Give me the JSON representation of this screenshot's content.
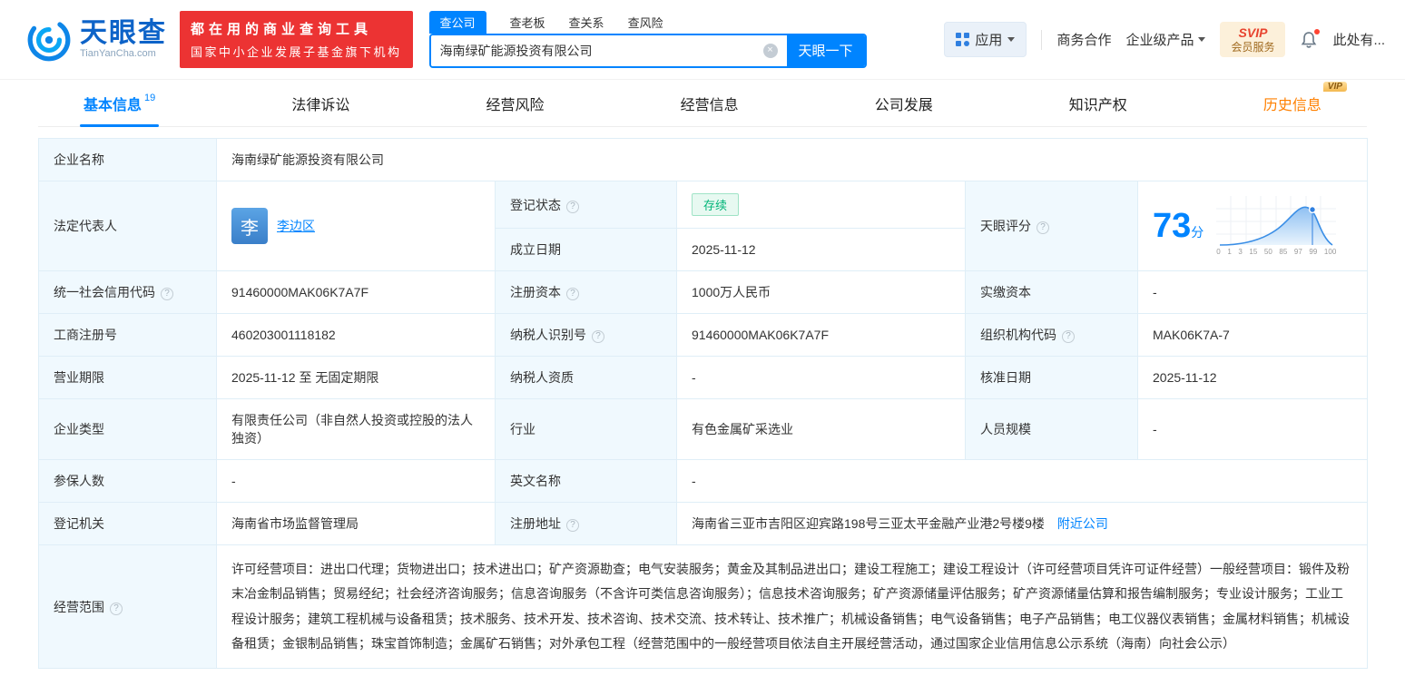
{
  "colors": {
    "primary": "#0084ff",
    "banner_red": "#ec3333",
    "status_green": "#00b578",
    "history_orange": "#ff8000"
  },
  "icons": {
    "clear": "×",
    "question": "?"
  },
  "header": {
    "logo_cn": "天眼查",
    "logo_en": "TianYanCha.com",
    "banner_line1": "都在用的商业查询工具",
    "banner_line2": "国家中小企业发展子基金旗下机构",
    "search_tabs": [
      {
        "label": "查公司"
      },
      {
        "label": "查老板"
      },
      {
        "label": "查关系"
      },
      {
        "label": "查风险"
      }
    ],
    "search_value": "海南绿矿能源投资有限公司",
    "search_button": "天眼一下",
    "apps_label": "应用",
    "biz_label": "商务合作",
    "enterprise_label": "企业级产品",
    "svip_brand": "SVIP",
    "svip_label": "会员服务",
    "notice_label": "此处有..."
  },
  "nav": {
    "tabs": [
      {
        "label": "基本信息",
        "count": "19"
      },
      {
        "label": "法律诉讼"
      },
      {
        "label": "经营风险"
      },
      {
        "label": "经营信息"
      },
      {
        "label": "公司发展"
      },
      {
        "label": "知识产权"
      },
      {
        "label": "历史信息",
        "vip": "VIP"
      }
    ]
  },
  "info": {
    "company_name_label": "企业名称",
    "company_name": "海南绿矿能源投资有限公司",
    "legal_rep_label": "法定代表人",
    "legal_rep_avatar": "李",
    "legal_rep_name": "李边区",
    "reg_status_label": "登记状态",
    "reg_status": "存续",
    "establish_label": "成立日期",
    "establish_date": "2025-11-12",
    "score_label": "天眼评分",
    "score_value": "73",
    "score_unit": "分",
    "score_axis": [
      "0",
      "1",
      "3",
      "15",
      "50",
      "85",
      "97",
      "99",
      "100"
    ],
    "credit_code_label": "统一社会信用代码",
    "credit_code": "91460000MAK06K7A7F",
    "reg_capital_label": "注册资本",
    "reg_capital": "1000万人民币",
    "paid_capital_label": "实缴资本",
    "paid_capital": "-",
    "reg_number_label": "工商注册号",
    "reg_number": "460203001118182",
    "taxpayer_id_label": "纳税人识别号",
    "taxpayer_id": "91460000MAK06K7A7F",
    "org_code_label": "组织机构代码",
    "org_code": "MAK06K7A-7",
    "business_term_label": "营业期限",
    "business_term": "2025-11-12 至 无固定期限",
    "taxpayer_quality_label": "纳税人资质",
    "taxpayer_quality": "-",
    "approval_date_label": "核准日期",
    "approval_date": "2025-11-12",
    "company_type_label": "企业类型",
    "company_type": "有限责任公司（非自然人投资或控股的法人独资）",
    "industry_label": "行业",
    "industry": "有色金属矿采选业",
    "staff_size_label": "人员规模",
    "staff_size": "-",
    "insured_label": "参保人数",
    "insured": "-",
    "english_name_label": "英文名称",
    "english_name": "-",
    "reg_authority_label": "登记机关",
    "reg_authority": "海南省市场监督管理局",
    "address_label": "注册地址",
    "address": "海南省三亚市吉阳区迎宾路198号三亚太平金融产业港2号楼9楼",
    "nearby_link": "附近公司",
    "scope_label": "经营范围",
    "scope": "许可经营项目：进出口代理；货物进出口；技术进出口；矿产资源勘查；电气安装服务；黄金及其制品进出口；建设工程施工；建设工程设计（许可经营项目凭许可证件经营）一般经营项目：锻件及粉末冶金制品销售；贸易经纪；社会经济咨询服务；信息咨询服务（不含许可类信息咨询服务）；信息技术咨询服务；矿产资源储量评估服务；矿产资源储量估算和报告编制服务；专业设计服务；工业工程设计服务；建筑工程机械与设备租赁；技术服务、技术开发、技术咨询、技术交流、技术转让、技术推广；机械设备销售；电气设备销售；电子产品销售；电工仪器仪表销售；金属材料销售；机械设备租赁；金银制品销售；珠宝首饰制造；金属矿石销售；对外承包工程（经营范围中的一般经营项目依法自主开展经营活动，通过国家企业信用信息公示系统（海南）向社会公示）"
  }
}
